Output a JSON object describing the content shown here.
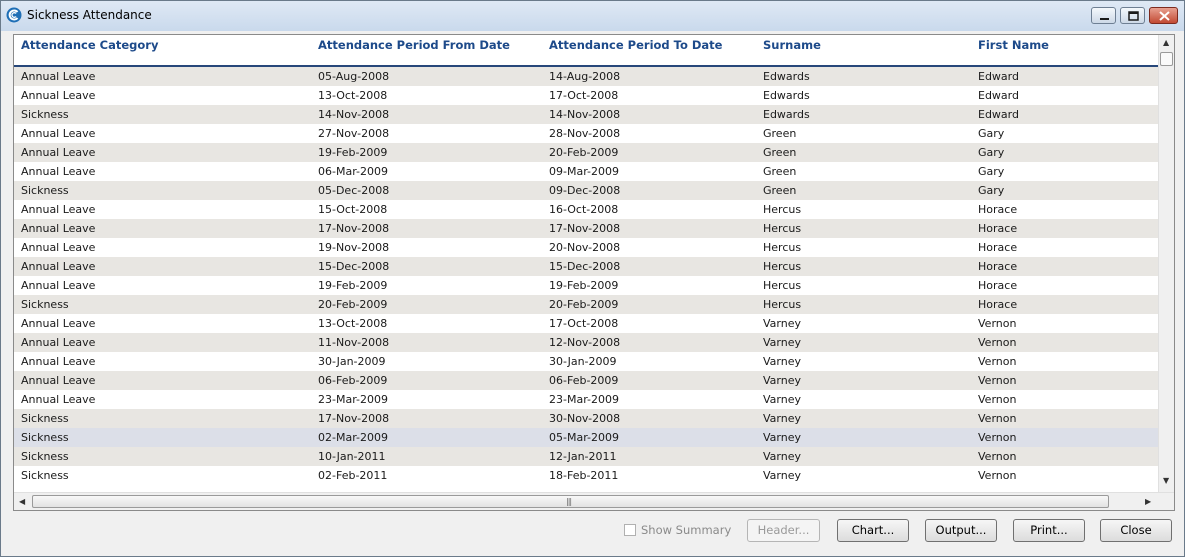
{
  "window": {
    "title": "Sickness Attendance",
    "colors": {
      "header_text": "#1d4a8a",
      "header_rule": "#27477a",
      "alt_row": "#e8e6e2",
      "selected_row": "#dcdfe8"
    }
  },
  "titlebar_buttons": {
    "minimize": "minimize-icon",
    "maximize": "maximize-icon",
    "close": "close-icon"
  },
  "table": {
    "columns": [
      "Attendance Category",
      "Attendance Period From Date",
      "Attendance Period To Date",
      "Surname",
      "First Name"
    ],
    "rows": [
      [
        "Annual Leave",
        "05-Aug-2008",
        "14-Aug-2008",
        "Edwards",
        "Edward"
      ],
      [
        "Annual Leave",
        "13-Oct-2008",
        "17-Oct-2008",
        "Edwards",
        "Edward"
      ],
      [
        "Sickness",
        "14-Nov-2008",
        "14-Nov-2008",
        "Edwards",
        "Edward"
      ],
      [
        "Annual Leave",
        "27-Nov-2008",
        "28-Nov-2008",
        "Green",
        "Gary"
      ],
      [
        "Annual Leave",
        "19-Feb-2009",
        "20-Feb-2009",
        "Green",
        "Gary"
      ],
      [
        "Annual Leave",
        "06-Mar-2009",
        "09-Mar-2009",
        "Green",
        "Gary"
      ],
      [
        "Sickness",
        "05-Dec-2008",
        "09-Dec-2008",
        "Green",
        "Gary"
      ],
      [
        "Annual Leave",
        "15-Oct-2008",
        "16-Oct-2008",
        "Hercus",
        "Horace"
      ],
      [
        "Annual Leave",
        "17-Nov-2008",
        "17-Nov-2008",
        "Hercus",
        "Horace"
      ],
      [
        "Annual Leave",
        "19-Nov-2008",
        "20-Nov-2008",
        "Hercus",
        "Horace"
      ],
      [
        "Annual Leave",
        "15-Dec-2008",
        "15-Dec-2008",
        "Hercus",
        "Horace"
      ],
      [
        "Annual Leave",
        "19-Feb-2009",
        "19-Feb-2009",
        "Hercus",
        "Horace"
      ],
      [
        "Sickness",
        "20-Feb-2009",
        "20-Feb-2009",
        "Hercus",
        "Horace"
      ],
      [
        "Annual Leave",
        "13-Oct-2008",
        "17-Oct-2008",
        "Varney",
        "Vernon"
      ],
      [
        "Annual Leave",
        "11-Nov-2008",
        "12-Nov-2008",
        "Varney",
        "Vernon"
      ],
      [
        "Annual Leave",
        "30-Jan-2009",
        "30-Jan-2009",
        "Varney",
        "Vernon"
      ],
      [
        "Annual Leave",
        "06-Feb-2009",
        "06-Feb-2009",
        "Varney",
        "Vernon"
      ],
      [
        "Annual Leave",
        "23-Mar-2009",
        "23-Mar-2009",
        "Varney",
        "Vernon"
      ],
      [
        "Sickness",
        "17-Nov-2008",
        "30-Nov-2008",
        "Varney",
        "Vernon"
      ],
      [
        "Sickness",
        "02-Mar-2009",
        "05-Mar-2009",
        "Varney",
        "Vernon"
      ],
      [
        "Sickness",
        "10-Jan-2011",
        "12-Jan-2011",
        "Varney",
        "Vernon"
      ],
      [
        "Sickness",
        "02-Feb-2011",
        "18-Feb-2011",
        "Varney",
        "Vernon"
      ]
    ],
    "selected_row": 19
  },
  "footer": {
    "show_summary_label": "Show Summary",
    "header_label": "Header...",
    "chart_label": "Chart...",
    "output_label": "Output...",
    "print_label": "Print...",
    "close_label": "Close"
  }
}
